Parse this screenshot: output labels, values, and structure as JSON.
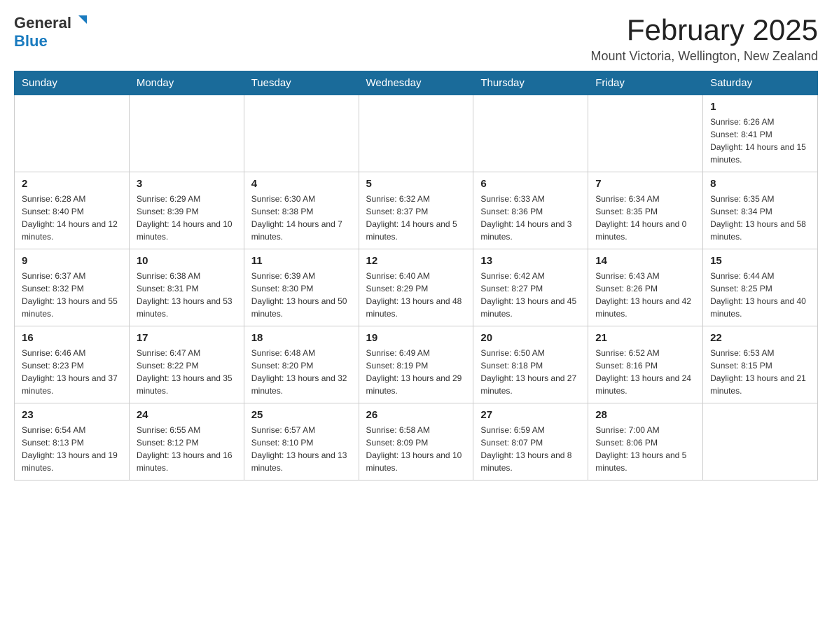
{
  "header": {
    "logo": {
      "general": "General",
      "blue": "Blue"
    },
    "title": "February 2025",
    "location": "Mount Victoria, Wellington, New Zealand"
  },
  "weekdays": [
    "Sunday",
    "Monday",
    "Tuesday",
    "Wednesday",
    "Thursday",
    "Friday",
    "Saturday"
  ],
  "weeks": [
    [
      {
        "day": "",
        "info": ""
      },
      {
        "day": "",
        "info": ""
      },
      {
        "day": "",
        "info": ""
      },
      {
        "day": "",
        "info": ""
      },
      {
        "day": "",
        "info": ""
      },
      {
        "day": "",
        "info": ""
      },
      {
        "day": "1",
        "info": "Sunrise: 6:26 AM\nSunset: 8:41 PM\nDaylight: 14 hours and 15 minutes."
      }
    ],
    [
      {
        "day": "2",
        "info": "Sunrise: 6:28 AM\nSunset: 8:40 PM\nDaylight: 14 hours and 12 minutes."
      },
      {
        "day": "3",
        "info": "Sunrise: 6:29 AM\nSunset: 8:39 PM\nDaylight: 14 hours and 10 minutes."
      },
      {
        "day": "4",
        "info": "Sunrise: 6:30 AM\nSunset: 8:38 PM\nDaylight: 14 hours and 7 minutes."
      },
      {
        "day": "5",
        "info": "Sunrise: 6:32 AM\nSunset: 8:37 PM\nDaylight: 14 hours and 5 minutes."
      },
      {
        "day": "6",
        "info": "Sunrise: 6:33 AM\nSunset: 8:36 PM\nDaylight: 14 hours and 3 minutes."
      },
      {
        "day": "7",
        "info": "Sunrise: 6:34 AM\nSunset: 8:35 PM\nDaylight: 14 hours and 0 minutes."
      },
      {
        "day": "8",
        "info": "Sunrise: 6:35 AM\nSunset: 8:34 PM\nDaylight: 13 hours and 58 minutes."
      }
    ],
    [
      {
        "day": "9",
        "info": "Sunrise: 6:37 AM\nSunset: 8:32 PM\nDaylight: 13 hours and 55 minutes."
      },
      {
        "day": "10",
        "info": "Sunrise: 6:38 AM\nSunset: 8:31 PM\nDaylight: 13 hours and 53 minutes."
      },
      {
        "day": "11",
        "info": "Sunrise: 6:39 AM\nSunset: 8:30 PM\nDaylight: 13 hours and 50 minutes."
      },
      {
        "day": "12",
        "info": "Sunrise: 6:40 AM\nSunset: 8:29 PM\nDaylight: 13 hours and 48 minutes."
      },
      {
        "day": "13",
        "info": "Sunrise: 6:42 AM\nSunset: 8:27 PM\nDaylight: 13 hours and 45 minutes."
      },
      {
        "day": "14",
        "info": "Sunrise: 6:43 AM\nSunset: 8:26 PM\nDaylight: 13 hours and 42 minutes."
      },
      {
        "day": "15",
        "info": "Sunrise: 6:44 AM\nSunset: 8:25 PM\nDaylight: 13 hours and 40 minutes."
      }
    ],
    [
      {
        "day": "16",
        "info": "Sunrise: 6:46 AM\nSunset: 8:23 PM\nDaylight: 13 hours and 37 minutes."
      },
      {
        "day": "17",
        "info": "Sunrise: 6:47 AM\nSunset: 8:22 PM\nDaylight: 13 hours and 35 minutes."
      },
      {
        "day": "18",
        "info": "Sunrise: 6:48 AM\nSunset: 8:20 PM\nDaylight: 13 hours and 32 minutes."
      },
      {
        "day": "19",
        "info": "Sunrise: 6:49 AM\nSunset: 8:19 PM\nDaylight: 13 hours and 29 minutes."
      },
      {
        "day": "20",
        "info": "Sunrise: 6:50 AM\nSunset: 8:18 PM\nDaylight: 13 hours and 27 minutes."
      },
      {
        "day": "21",
        "info": "Sunrise: 6:52 AM\nSunset: 8:16 PM\nDaylight: 13 hours and 24 minutes."
      },
      {
        "day": "22",
        "info": "Sunrise: 6:53 AM\nSunset: 8:15 PM\nDaylight: 13 hours and 21 minutes."
      }
    ],
    [
      {
        "day": "23",
        "info": "Sunrise: 6:54 AM\nSunset: 8:13 PM\nDaylight: 13 hours and 19 minutes."
      },
      {
        "day": "24",
        "info": "Sunrise: 6:55 AM\nSunset: 8:12 PM\nDaylight: 13 hours and 16 minutes."
      },
      {
        "day": "25",
        "info": "Sunrise: 6:57 AM\nSunset: 8:10 PM\nDaylight: 13 hours and 13 minutes."
      },
      {
        "day": "26",
        "info": "Sunrise: 6:58 AM\nSunset: 8:09 PM\nDaylight: 13 hours and 10 minutes."
      },
      {
        "day": "27",
        "info": "Sunrise: 6:59 AM\nSunset: 8:07 PM\nDaylight: 13 hours and 8 minutes."
      },
      {
        "day": "28",
        "info": "Sunrise: 7:00 AM\nSunset: 8:06 PM\nDaylight: 13 hours and 5 minutes."
      },
      {
        "day": "",
        "info": ""
      }
    ]
  ]
}
